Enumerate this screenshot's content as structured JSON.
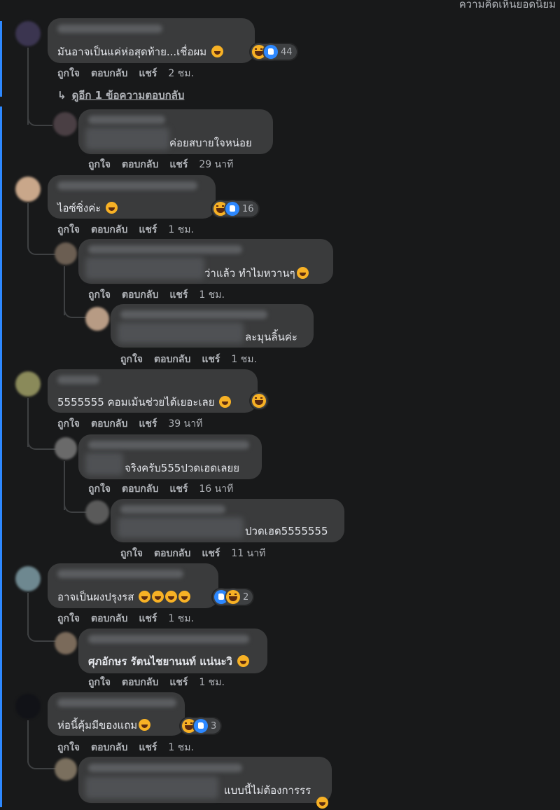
{
  "header": {
    "top_comments_label": "ความคิดเห็นยอดนิยม"
  },
  "actions": {
    "like": "ถูกใจ",
    "reply": "ตอบกลับ",
    "share": "แชร์"
  },
  "comments": [
    {
      "text": "มันอาจเป็นแค่ห่อสุดท้าย...เชื่อผม",
      "time": "2 ชม.",
      "reactions": "44",
      "view_replies": "ดูอีก 1 ข้อความตอบกลับ"
    },
    {
      "text": "ค่อยสบายใจหน่อย",
      "time": "29 นาที"
    },
    {
      "text": "ไอซ์ซิ่งค่ะ",
      "time": "1 ชม.",
      "reactions": "16"
    },
    {
      "text": "ว่าแล้ว ทำไมหวานๆ",
      "time": "1 ชม."
    },
    {
      "text": "ละมุนลิ้นค่ะ",
      "time": "1 ชม."
    },
    {
      "text": "5555555 คอมเม้นช่วยได้เยอะเลย",
      "time": "39 นาที"
    },
    {
      "text": "จริงครับ555ปวดเฮดเลยย",
      "time": "16 นาที"
    },
    {
      "text": "ปวดเฮด5555555",
      "time": "11 นาที"
    },
    {
      "text": "อาจเป็นผงปรุงรส",
      "time": "1 ชม.",
      "reactions": "2"
    },
    {
      "text": "ศุภอักษร รัตนไชยานนท์ แน่นะวิ",
      "time": "1 ชม."
    },
    {
      "text": "ห่อนี้คุ้มมีของแถม",
      "time": "1 ชม.",
      "reactions": "3"
    },
    {
      "text": "แบบนี้ไม่ต้องการรร"
    }
  ],
  "icons": {
    "reaction_haha": "haha-reaction-icon",
    "reaction_like": "like-reaction-icon",
    "reply_arrow": "reply-arrow-icon"
  },
  "colors": {
    "background": "#18191a",
    "bubble": "#3a3b3c",
    "accent": "#2d88ff",
    "text": "#e4e6eb",
    "muted": "#b0b3b8"
  }
}
